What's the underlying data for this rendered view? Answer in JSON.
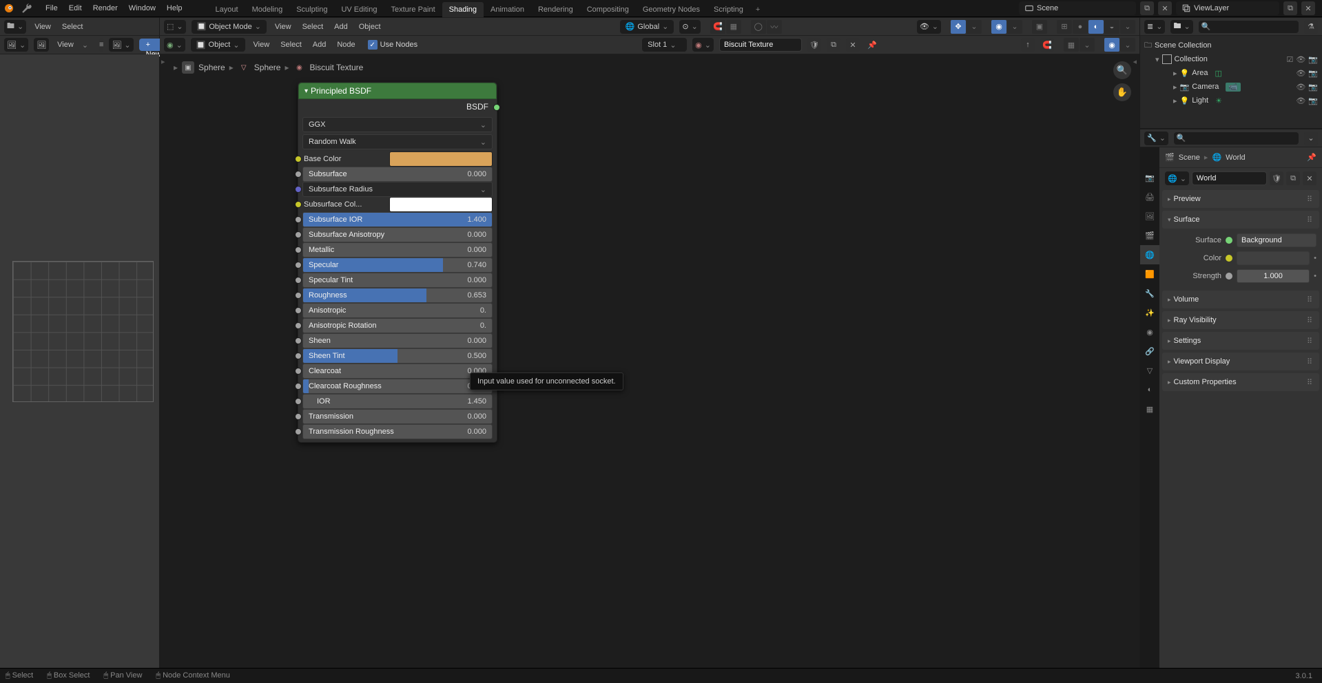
{
  "app": {
    "menus": [
      "File",
      "Edit",
      "Render",
      "Window",
      "Help"
    ],
    "workspaces": [
      "Layout",
      "Modeling",
      "Sculpting",
      "UV Editing",
      "Texture Paint",
      "Shading",
      "Animation",
      "Rendering",
      "Compositing",
      "Geometry Nodes",
      "Scripting"
    ],
    "active_workspace": "Shading",
    "scene": "Scene",
    "view_layer": "ViewLayer",
    "version": "3.0.1"
  },
  "left_3d_header": {
    "view": "View",
    "select": "Select"
  },
  "center_3d_header": {
    "mode": "Object Mode",
    "menus": [
      "View",
      "Select",
      "Add",
      "Object"
    ],
    "orientation": "Global"
  },
  "shader_header": {
    "material": "Object",
    "menus": [
      "View",
      "Select",
      "Add",
      "Node"
    ],
    "use_nodes_label": "Use Nodes",
    "slot": "Slot 1",
    "material_name": "Biscuit Texture",
    "new_label": "New"
  },
  "breadcrumb": [
    "Sphere",
    "Sphere",
    "Biscuit Texture"
  ],
  "node": {
    "title": "Principled BSDF",
    "output": "BSDF",
    "distribution": "GGX",
    "sss_method": "Random Walk",
    "rows": [
      {
        "kind": "color",
        "label": "Base Color",
        "swatch": "#d9a35a",
        "socket": "col-yellow"
      },
      {
        "kind": "slider",
        "label": "Subsurface",
        "value": "0.000",
        "fill": 0,
        "socket": "col-gray"
      },
      {
        "kind": "dropdown",
        "label": "Subsurface Radius",
        "socket": "col-purple"
      },
      {
        "kind": "color",
        "label": "Subsurface Col...",
        "swatch": "#ffffff",
        "socket": "col-yellow"
      },
      {
        "kind": "slider",
        "label": "Subsurface IOR",
        "value": "1.400",
        "fill": 100,
        "socket": "col-gray"
      },
      {
        "kind": "slider",
        "label": "Subsurface Anisotropy",
        "value": "0.000",
        "fill": 0,
        "socket": "col-gray"
      },
      {
        "kind": "slider",
        "label": "Metallic",
        "value": "0.000",
        "fill": 0,
        "socket": "col-gray"
      },
      {
        "kind": "slider",
        "label": "Specular",
        "value": "0.740",
        "fill": 74,
        "socket": "col-gray"
      },
      {
        "kind": "slider",
        "label": "Specular Tint",
        "value": "0.000",
        "fill": 0,
        "socket": "col-gray"
      },
      {
        "kind": "slider",
        "label": "Roughness",
        "value": "0.653",
        "fill": 65.3,
        "socket": "col-gray"
      },
      {
        "kind": "slider",
        "label": "Anisotropic",
        "value": "0.",
        "fill": 0,
        "socket": "col-gray"
      },
      {
        "kind": "slider",
        "label": "Anisotropic Rotation",
        "value": "0.",
        "fill": 0,
        "socket": "col-gray"
      },
      {
        "kind": "slider",
        "label": "Sheen",
        "value": "0.000",
        "fill": 0,
        "socket": "col-gray"
      },
      {
        "kind": "slider",
        "label": "Sheen Tint",
        "value": "0.500",
        "fill": 50,
        "socket": "col-gray"
      },
      {
        "kind": "slider",
        "label": "Clearcoat",
        "value": "0.000",
        "fill": 0,
        "socket": "col-gray"
      },
      {
        "kind": "slider",
        "label": "Clearcoat Roughness",
        "value": "0.030",
        "fill": 3,
        "socket": "col-gray"
      },
      {
        "kind": "value",
        "label": "IOR",
        "value": "1.450",
        "socket": "col-gray"
      },
      {
        "kind": "slider",
        "label": "Transmission",
        "value": "0.000",
        "fill": 0,
        "socket": "col-gray"
      },
      {
        "kind": "slider",
        "label": "Transmission Roughness",
        "value": "0.000",
        "fill": 0,
        "socket": "col-gray"
      }
    ]
  },
  "tooltip": "Input value used for unconnected socket.",
  "outliner": {
    "root": "Scene Collection",
    "collection": "Collection",
    "items": [
      "Area",
      "Camera",
      "Light"
    ]
  },
  "properties": {
    "scene": "Scene",
    "world": "World",
    "world_name": "World",
    "panels": {
      "preview": "Preview",
      "surface": "Surface",
      "volume": "Volume",
      "ray": "Ray Visibility",
      "settings": "Settings",
      "viewport": "Viewport Display",
      "custom": "Custom Properties"
    },
    "surface_shader_label": "Surface",
    "surface_shader": "Background",
    "color_label": "Color",
    "strength_label": "Strength",
    "strength_value": "1.000"
  },
  "status": {
    "select": "Select",
    "box": "Box Select",
    "pan": "Pan View",
    "context": "Node Context Menu"
  }
}
